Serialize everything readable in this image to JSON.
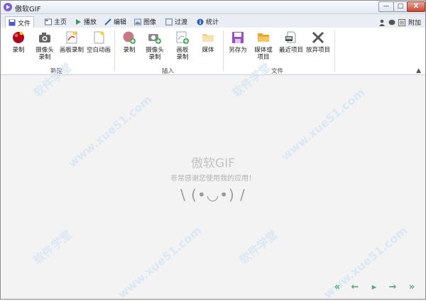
{
  "window": {
    "title": "傲软GIF",
    "min_label": "—",
    "max_label": "□",
    "close_label": "X"
  },
  "tabs": [
    {
      "label": "文件",
      "active": true
    },
    {
      "label": "主页"
    },
    {
      "label": "播放"
    },
    {
      "label": "编辑"
    },
    {
      "label": "图像"
    },
    {
      "label": "过渡"
    },
    {
      "label": "统计"
    }
  ],
  "top_right": {
    "attach_label": "附加"
  },
  "ribbon": {
    "groups": {
      "new": {
        "label": "新建",
        "items": [
          "录制",
          "摄像头录制",
          "画板录制",
          "空白动画"
        ]
      },
      "insert": {
        "label": "插入",
        "items": [
          "录制",
          "摄像头录制",
          "画板录制",
          "媒体"
        ]
      },
      "file": {
        "label": "文件",
        "items": [
          "另存为",
          "媒体或项目",
          "最近项目",
          "放弃项目"
        ]
      }
    }
  },
  "center": {
    "title": "傲软GIF",
    "subtitle": "非常感谢您使用我的应用！",
    "face": "\\ (•◡•) /"
  },
  "watermarks": [
    "软件学堂",
    "www.xue51.com"
  ],
  "colors": {
    "accent": "#2a6fb0",
    "record_red": "#b0001a",
    "folder": "#f2b84b",
    "nav_green": "#5aa87a",
    "watermark": "#d9e6f2"
  }
}
